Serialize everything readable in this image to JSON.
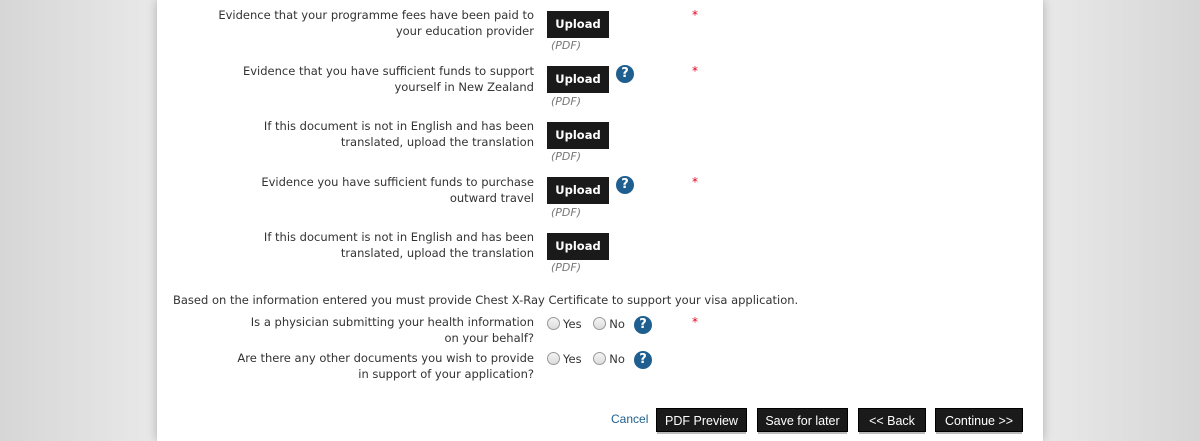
{
  "documents": [
    {
      "label": "Evidence that your programme fees have been paid to your education provider",
      "required": true,
      "upload_label": "Upload",
      "format": "(PDF)",
      "help": false
    },
    {
      "label": "Evidence that you have sufficient funds to support yourself in New Zealand",
      "required": true,
      "upload_label": "Upload",
      "format": "(PDF)",
      "help": true
    },
    {
      "label": "If this document is not in English and has been translated, upload the translation",
      "required": false,
      "upload_label": "Upload",
      "format": "(PDF)",
      "help": false
    },
    {
      "label": "Evidence you have sufficient funds to purchase outward travel",
      "required": true,
      "upload_label": "Upload",
      "format": "(PDF)",
      "help": true
    },
    {
      "label": "If this document is not in English and has been translated, upload the translation",
      "required": false,
      "upload_label": "Upload",
      "format": "(PDF)",
      "help": false
    }
  ],
  "info_text": "Based on the information entered you must provide Chest X-Ray Certificate to support your visa application.",
  "questions": [
    {
      "label": "Is a physician submitting your health information on your behalf?",
      "required": true,
      "yes": "Yes",
      "no": "No"
    },
    {
      "label": "Are there any other documents you wish to provide in support of your application?",
      "required": false,
      "yes": "Yes",
      "no": "No"
    }
  ],
  "required_mark": "*",
  "help_glyph": "?",
  "actions": {
    "cancel": "Cancel",
    "pdf_preview": "PDF Preview",
    "save_for_later": "Save for later",
    "back": "<< Back",
    "continue": "Continue >>"
  },
  "colors": {
    "button_bg": "#1a1a1a",
    "help_icon": "#1f5f8f",
    "required": "#e0001b",
    "link": "#1f5f8f"
  }
}
